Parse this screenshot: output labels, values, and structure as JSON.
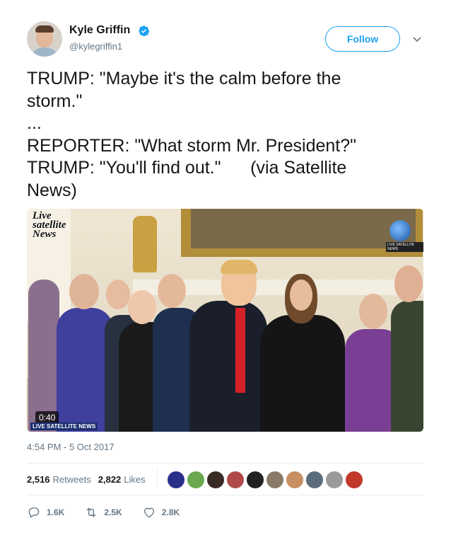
{
  "author": {
    "name": "Kyle Griffin",
    "handle": "@kylegriffin1"
  },
  "follow_label": "Follow",
  "tweet": {
    "text": "TRUMP: \"Maybe it's the calm before the\nstorm.\"\n...\nREPORTER: \"What storm Mr. President?\"\nTRUMP: \"You'll find out.\"      (via Satellite\nNews)"
  },
  "media": {
    "duration": "0:40",
    "watermark_top": "Live satellite News",
    "watermark_bottom": "LIVE SATELLITE NEWS"
  },
  "timestamp": "4:54 PM - 5 Oct 2017",
  "stats": {
    "retweets_count": "2,516",
    "retweets_label": "Retweets",
    "likes_count": "2,822",
    "likes_label": "Likes"
  },
  "actions": {
    "replies": "1.6K",
    "retweets": "2.5K",
    "likes": "2.8K"
  },
  "colors": {
    "accent": "#1da1f2",
    "muted": "#657786",
    "text": "#14171a"
  },
  "icons": [
    "verified-badge-icon",
    "chevron-down-icon",
    "reply-icon",
    "retweet-icon",
    "heart-icon"
  ]
}
